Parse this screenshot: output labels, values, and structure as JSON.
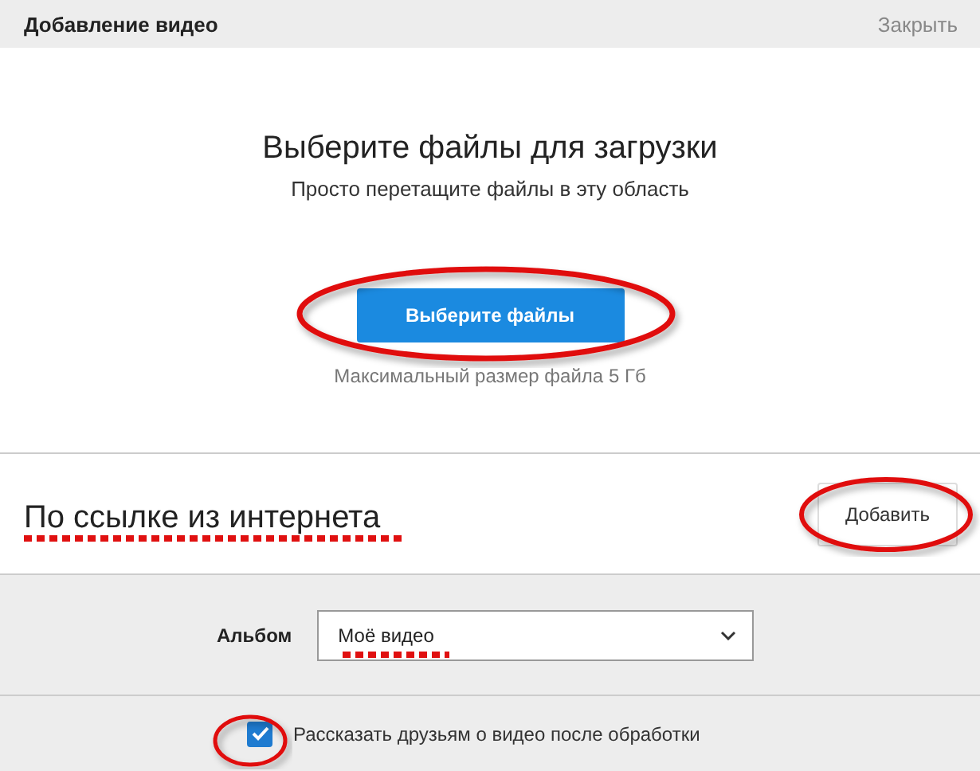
{
  "window": {
    "title": "Добавление видео",
    "close": "Закрыть"
  },
  "upload": {
    "title": "Выберите файлы для загрузки",
    "subtitle": "Просто перетащите файлы в эту область",
    "button": "Выберите файлы",
    "limit": "Максимальный размер файла 5 Гб"
  },
  "link": {
    "title": "По ссылке из интернета",
    "button": "Добавить"
  },
  "album": {
    "label": "Альбом",
    "value": "Моё видео"
  },
  "share": {
    "label": "Рассказать друзьям о видео после обработки",
    "checked": true
  }
}
